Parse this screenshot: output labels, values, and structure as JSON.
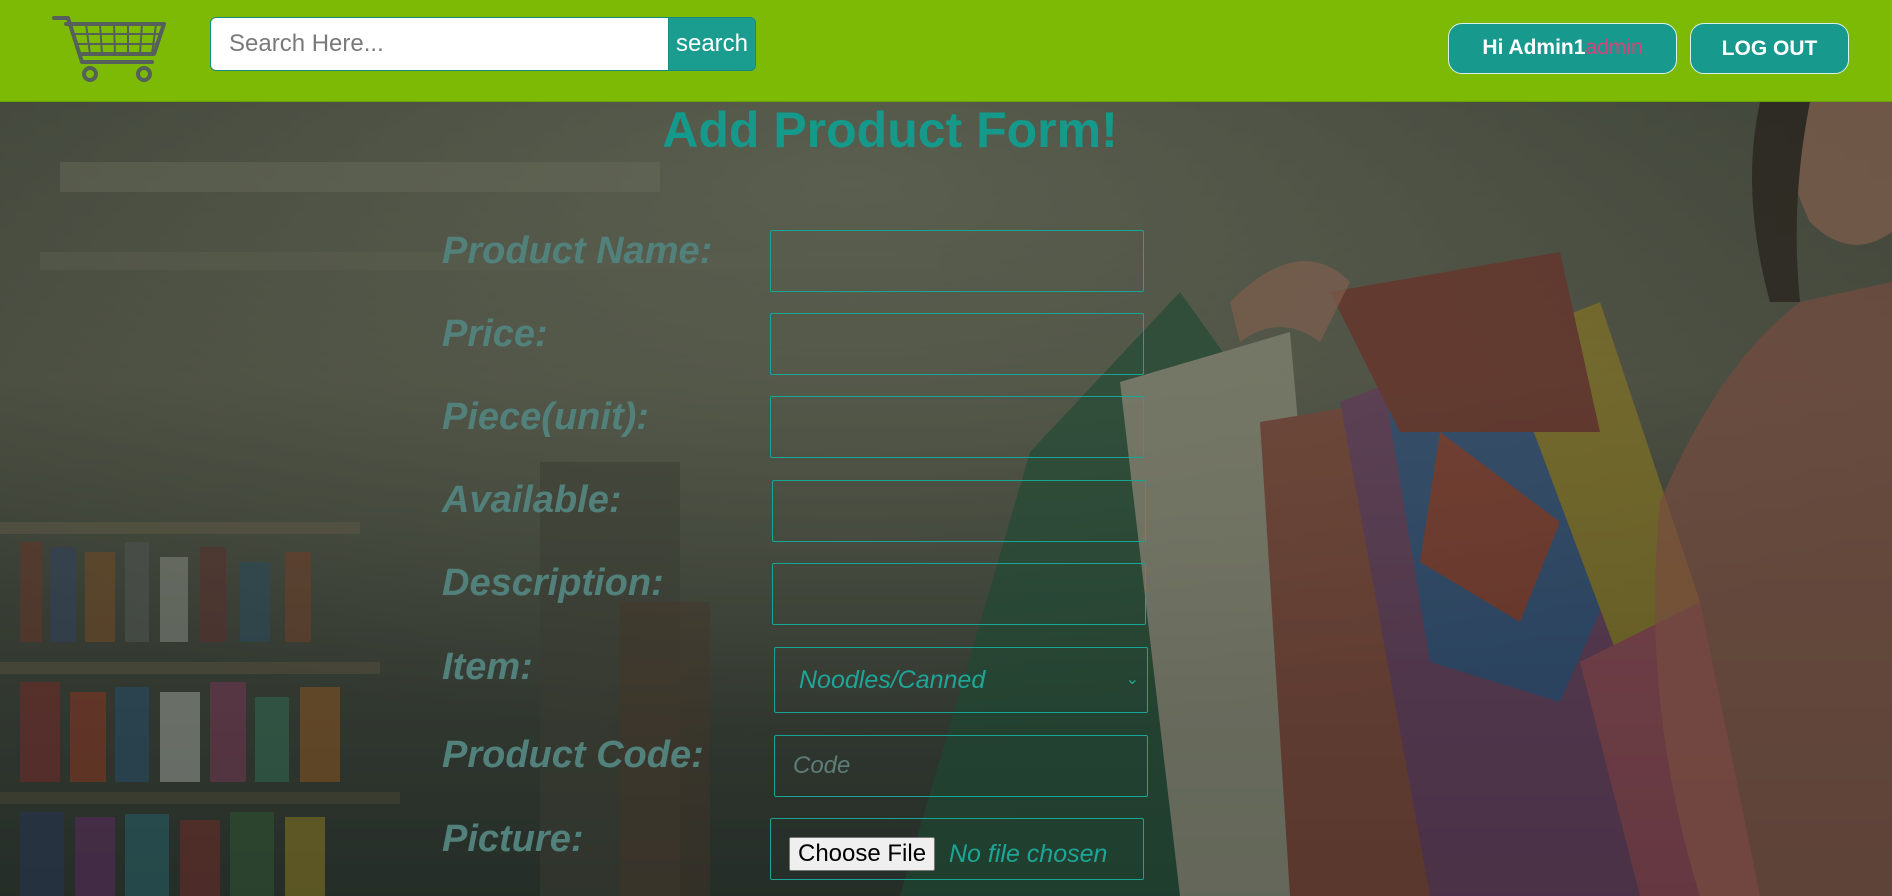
{
  "header": {
    "logo_icon": "shopping-cart-icon",
    "search": {
      "placeholder": "Search Here...",
      "value": "",
      "button_label": "search"
    },
    "greeting": {
      "prefix": "Hi Admin1",
      "role": "admin"
    },
    "logout_label": "LOG OUT"
  },
  "form": {
    "title": "Add Product Form!",
    "fields": {
      "product_name": {
        "label": "Product Name:",
        "value": ""
      },
      "price": {
        "label": "Price:",
        "value": ""
      },
      "piece_unit": {
        "label": "Piece(unit):",
        "value": ""
      },
      "available": {
        "label": "Available:",
        "value": ""
      },
      "description": {
        "label": "Description:",
        "value": ""
      },
      "item": {
        "label": "Item:",
        "selected": "Noodles/Canned"
      },
      "product_code": {
        "label": "Product Code:",
        "placeholder": "Code",
        "value": ""
      },
      "picture": {
        "label": "Picture:",
        "button_label": "Choose File",
        "status": "No file chosen"
      }
    }
  },
  "colors": {
    "header_bg": "#7cba06",
    "accent": "#17998d",
    "label_text": "#52817b",
    "role_text": "#d6437a"
  }
}
